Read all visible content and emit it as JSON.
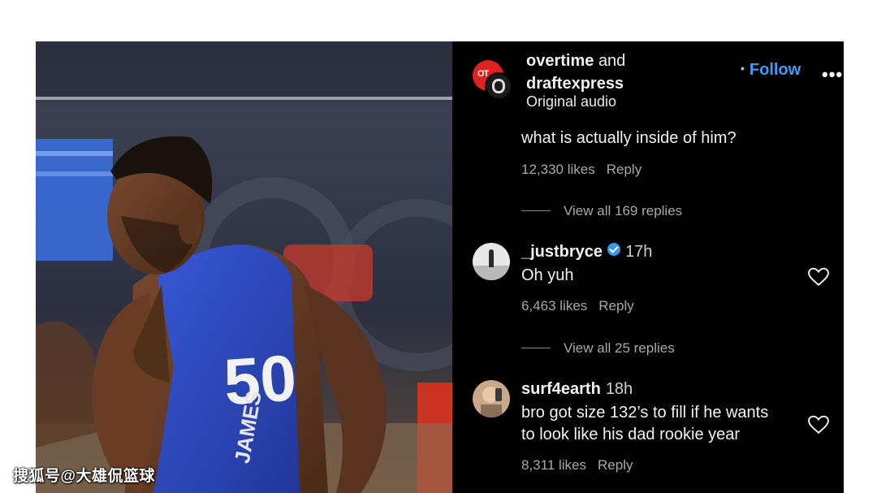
{
  "watermark": "搜狐号@大雄侃篮球",
  "video": {
    "jersey_number": "50",
    "jersey_name": "JAMES"
  },
  "header": {
    "account_1": "overtime",
    "joiner": "and",
    "account_2": "draftexpress",
    "audio": "Original audio",
    "follow_label": "Follow",
    "more": "•••"
  },
  "comments": [
    {
      "text": "what is actually inside of him?",
      "likes": "12,330 likes",
      "reply_label": "Reply",
      "view_replies": "View all 169 replies"
    },
    {
      "username": "_justbryce",
      "verified": true,
      "time": "17h",
      "text": "Oh yuh",
      "likes": "6,463 likes",
      "reply_label": "Reply",
      "view_replies": "View all 25 replies"
    },
    {
      "username": "surf4earth",
      "time": "18h",
      "text_line1": "bro got size 132’s to fill if he wants",
      "text_line2": "to look like his dad rookie year",
      "likes": "8,311 likes",
      "reply_label": "Reply"
    }
  ],
  "colors": {
    "panel_bg": "#000000",
    "follow_blue": "#3d9cf5",
    "verified_blue": "#3897f0",
    "jersey_blue": "#2d4fc4",
    "muted_text": "#a8a8a8"
  }
}
